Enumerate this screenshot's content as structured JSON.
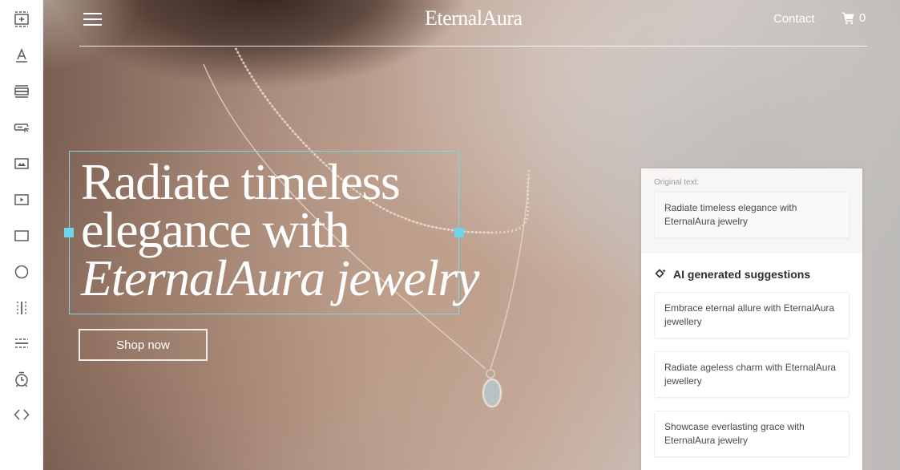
{
  "toolbar": {
    "tools": [
      {
        "name": "add-section",
        "icon": "add-section-icon"
      },
      {
        "name": "text",
        "icon": "text-icon"
      },
      {
        "name": "layout",
        "icon": "layout-icon"
      },
      {
        "name": "button",
        "icon": "button-icon"
      },
      {
        "name": "image",
        "icon": "image-icon"
      },
      {
        "name": "video",
        "icon": "video-icon"
      },
      {
        "name": "rectangle",
        "icon": "rectangle-icon"
      },
      {
        "name": "circle",
        "icon": "circle-icon"
      },
      {
        "name": "vertical-divider",
        "icon": "vertical-divider-icon"
      },
      {
        "name": "horizontal-divider",
        "icon": "horizontal-divider-icon"
      },
      {
        "name": "timer",
        "icon": "timer-icon"
      },
      {
        "name": "code",
        "icon": "code-icon"
      }
    ]
  },
  "header": {
    "brand": "EternalAura",
    "contact": "Contact",
    "cart_count": "0"
  },
  "hero": {
    "headline_line1": "Radiate timeless",
    "headline_line2": "elegance with",
    "headline_line3": "EternalAura jewelry",
    "cta": "Shop now"
  },
  "ai_panel": {
    "original_label": "Original text:",
    "original_text": "Radiate timeless elegance with EternalAura jewelry",
    "suggestions_title": "AI generated suggestions",
    "suggestions": [
      "Embrace eternal allure with EternalAura jewellery",
      "Radiate ageless charm with EternalAura jewellery",
      "Showcase everlasting grace with EternalAura jewelry"
    ]
  },
  "colors": {
    "selection": "#7fd6e6",
    "handle": "#6fd3ea"
  }
}
